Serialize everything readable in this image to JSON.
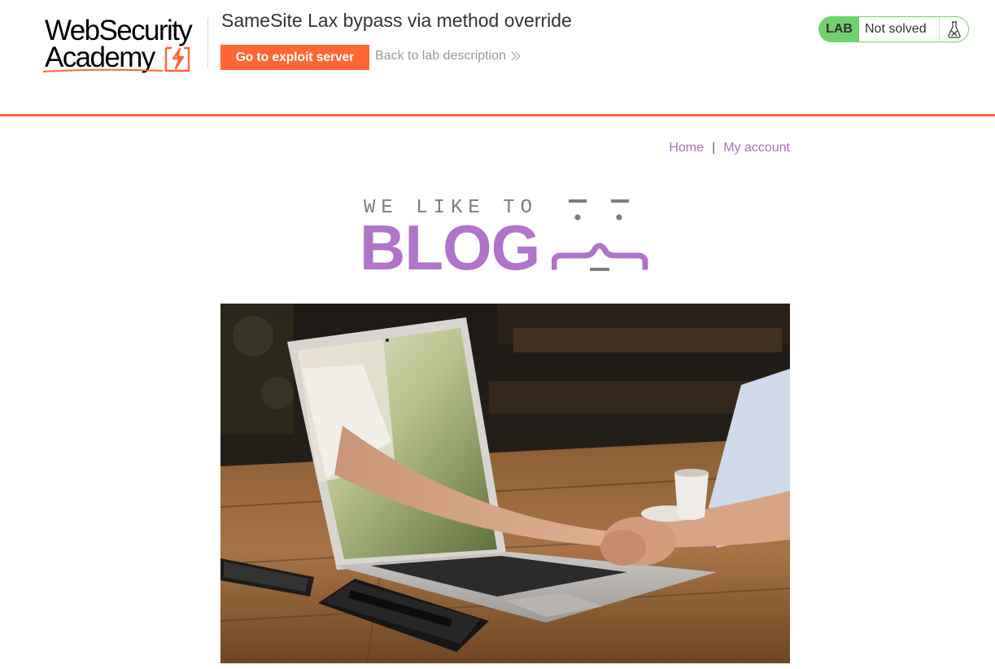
{
  "header": {
    "logo_line1": "WebSecurity",
    "logo_line2": "Academy",
    "lab_title": "SameSite Lax bypass via method override",
    "exploit_button_label": "Go to exploit server",
    "back_link_label": "Back to lab description",
    "lab_badge": "LAB",
    "lab_status": "Not solved",
    "accent_color": "#ff6633",
    "status_color": "#70d16d",
    "icons": [
      "lightning-icon",
      "chevrons-right-icon",
      "flask-icon"
    ]
  },
  "nav": {
    "home_label": "Home",
    "separator": "|",
    "account_label": "My account"
  },
  "blog_header": {
    "tagline": "WE LIKE TO",
    "title": "BLOG",
    "brand_color": "#b074c8"
  },
  "hero": {
    "alt": "Hands shaking through a laptop screen on a wooden table"
  }
}
